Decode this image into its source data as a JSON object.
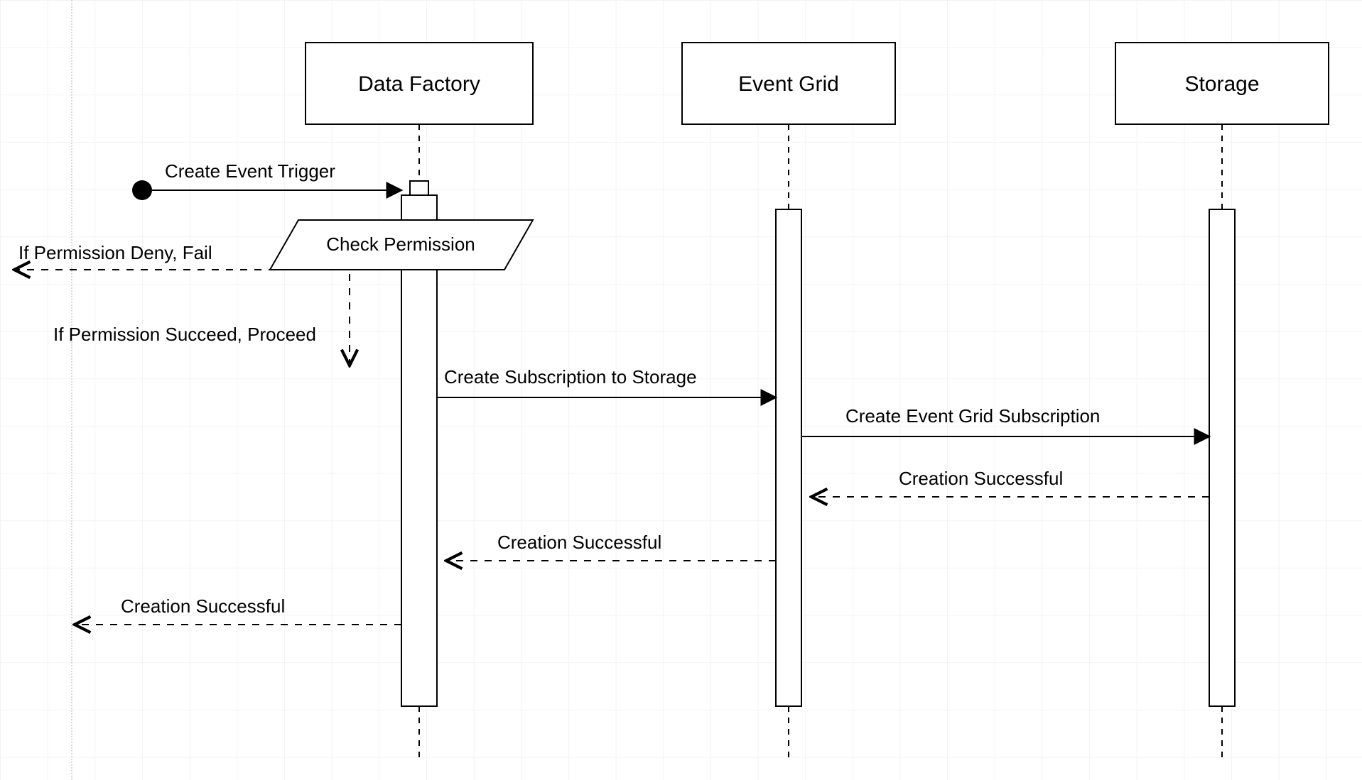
{
  "diagram": {
    "participants": {
      "data_factory": "Data Factory",
      "event_grid": "Event Grid",
      "storage": "Storage"
    },
    "messages": {
      "create_event_trigger": "Create Event Trigger",
      "check_permission": "Check Permission",
      "permission_deny": "If Permission Deny, Fail",
      "permission_succeed": "If Permission Succeed, Proceed",
      "create_subscription_storage": "Create Subscription to Storage",
      "create_event_grid_subscription": "Create Event Grid Subscription",
      "creation_successful_1": "Creation Successful",
      "creation_successful_2": "Creation Successful",
      "creation_successful_3": "Creation Successful"
    }
  }
}
